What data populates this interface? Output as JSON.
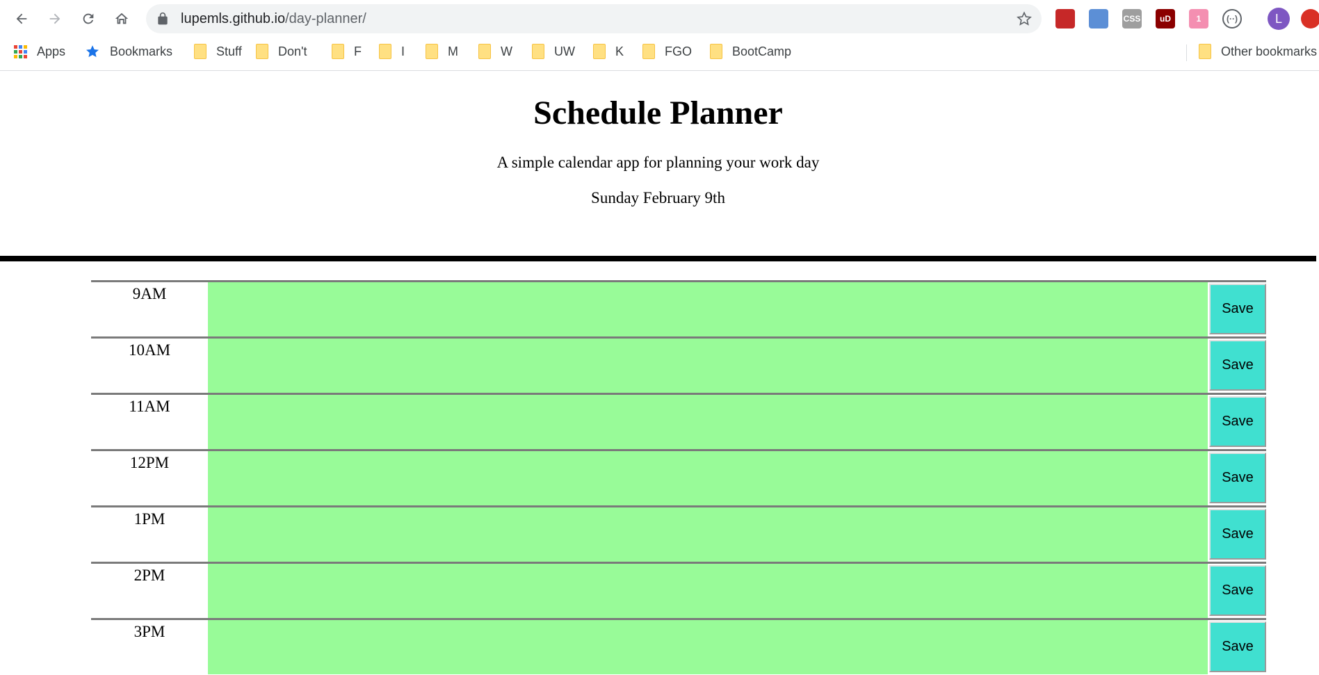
{
  "browser": {
    "url_host": "lupemls.github.io",
    "url_path": "/day-planner/",
    "avatar_letter": "L",
    "extensions": [
      {
        "name": "ext-flag",
        "label": "",
        "color": "#c62828"
      },
      {
        "name": "ext-blue",
        "label": "",
        "color": "#5c8fd6"
      },
      {
        "name": "ext-css",
        "label": "CSS",
        "color": "#9e9e9e"
      },
      {
        "name": "ext-ublock",
        "label": "uD",
        "color": "#8b0000"
      },
      {
        "name": "ext-pink",
        "label": "1",
        "color": "#f48fb1"
      },
      {
        "name": "ext-circle",
        "label": "(··)",
        "color": "#ffffff"
      }
    ]
  },
  "bookmarks": {
    "apps": "Apps",
    "bookmarks": "Bookmarks",
    "folders": [
      "Stuff",
      "Don't",
      "F",
      "I",
      "M",
      "W",
      "UW",
      "K",
      "FGO",
      "BootCamp"
    ],
    "other": "Other bookmarks"
  },
  "header": {
    "title": "Schedule Planner",
    "lead": "A simple calendar app for planning your work day",
    "current_day": "Sunday February 9th"
  },
  "schedule": {
    "save_label": "Save",
    "slot_color": "#98fb98",
    "save_color": "#40e0d0",
    "hours": [
      {
        "label": "9AM",
        "text": ""
      },
      {
        "label": "10AM",
        "text": ""
      },
      {
        "label": "11AM",
        "text": ""
      },
      {
        "label": "12PM",
        "text": ""
      },
      {
        "label": "1PM",
        "text": ""
      },
      {
        "label": "2PM",
        "text": ""
      },
      {
        "label": "3PM",
        "text": ""
      }
    ]
  }
}
